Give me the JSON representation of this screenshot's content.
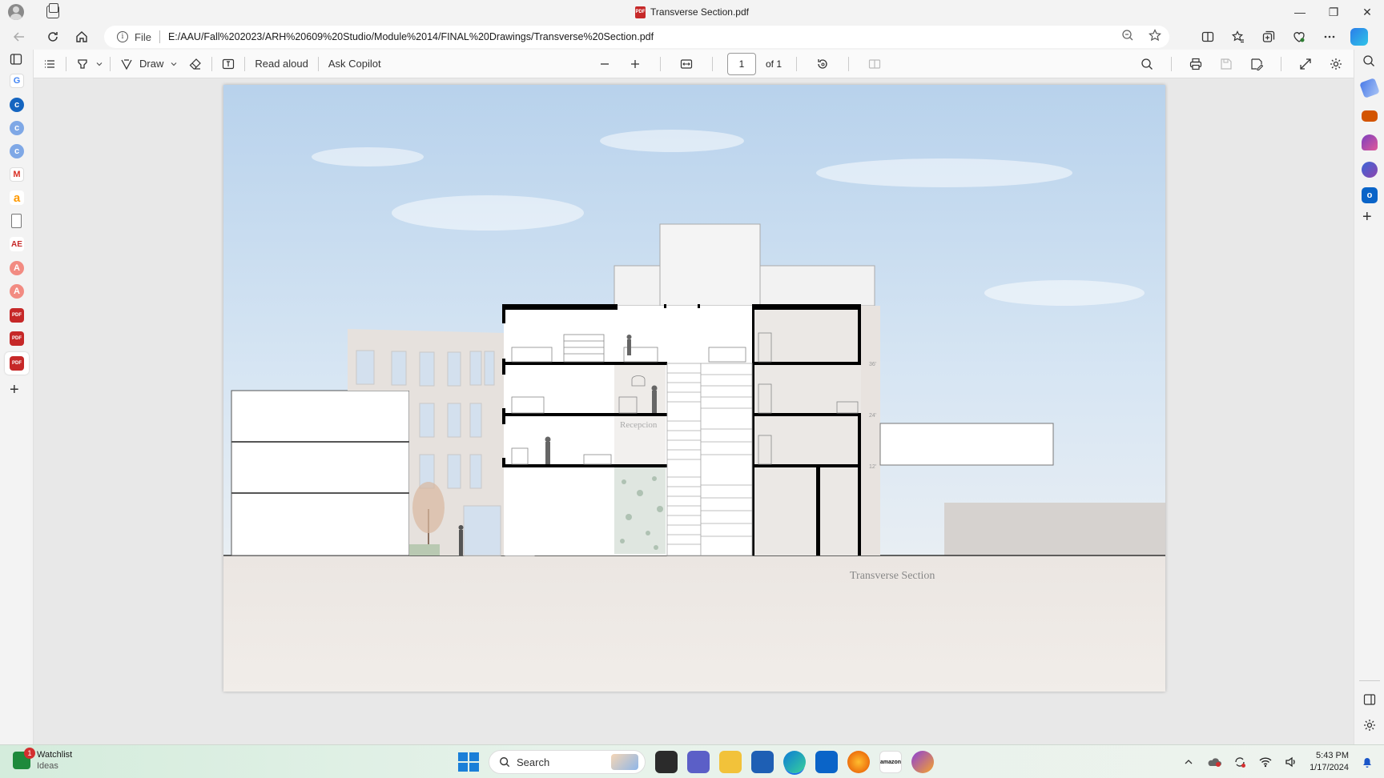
{
  "window": {
    "title": "Transverse Section.pdf",
    "pdf_badge": "PDF",
    "controls": {
      "minimize": "—",
      "restore": "❐",
      "close": "✕"
    }
  },
  "address": {
    "scheme": "File",
    "url": "E:/AAU/Fall%202023/ARH%20609%20Studio/Module%2014/FINAL%20Drawings/Transverse%20Section.pdf"
  },
  "pdf_toolbar": {
    "draw_label": "Draw",
    "read_aloud_label": "Read aloud",
    "ask_copilot_label": "Ask Copilot",
    "page_current": "1",
    "page_total": "of 1"
  },
  "drawing": {
    "caption": "Transverse Section",
    "room_label": "Recepcion",
    "level_marks": [
      "36'",
      "24'",
      "12'"
    ]
  },
  "taskbar": {
    "widget_title": "Watchlist",
    "widget_sub": "Ideas",
    "widget_badge": "1",
    "search_label": "Search",
    "time": "5:43 PM",
    "date": "1/17/2024",
    "amazon_label": "amazon"
  }
}
